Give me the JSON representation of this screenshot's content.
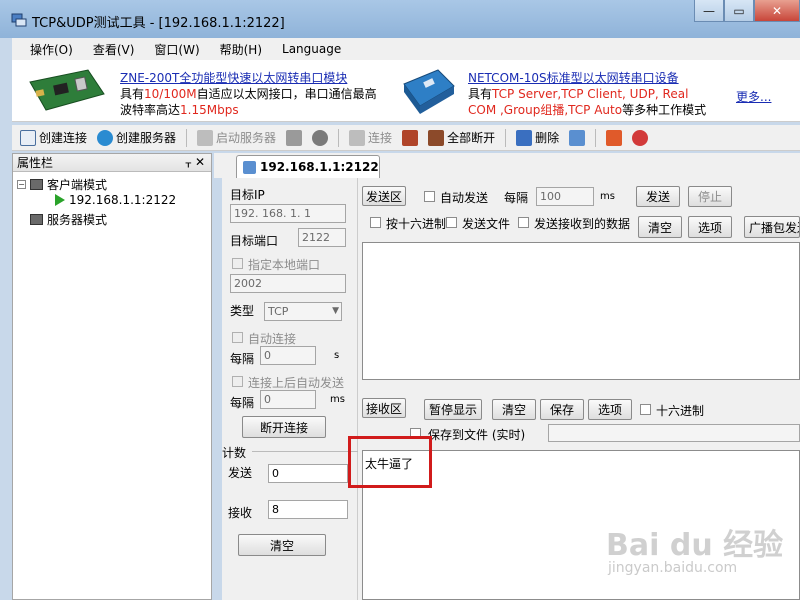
{
  "window": {
    "title": "TCP&UDP测试工具 - [192.168.1.1:2122]"
  },
  "menu": {
    "items": [
      "操作(O)",
      "查看(V)",
      "窗口(W)",
      "帮助(H)",
      "Language"
    ]
  },
  "banner": {
    "product1_title": "ZNE-200T全功能型快速以太网转串口模块",
    "product1_line2a": "具有",
    "product1_line2b": "10/100M",
    "product1_line2c": "自适应以太网接口，串口通信最高",
    "product1_line3a": "波特率高达",
    "product1_line3b": "1.15Mbps",
    "product2_title": "NETCOM-10S标准型以太网转串口设备",
    "product2_line2a": "具有",
    "product2_line2b": "TCP Server,TCP Client, UDP, Real",
    "product2_line3a": "COM ,Group组播,TCP Auto",
    "product2_line3b": "等多种工作模式",
    "more_link": "更多..."
  },
  "toolbar": {
    "create_connection": "创建连接",
    "create_server": "创建服务器",
    "start_server": "启动服务器",
    "connect": "连接",
    "disconnect_all": "全部断开",
    "delete": "删除"
  },
  "left_panel": {
    "title": "属性栏",
    "client_mode": "客户端模式",
    "client_item": "192.168.1.1:2122",
    "server_mode": "服务器模式"
  },
  "tab": {
    "label": "192.168.1.1:2122"
  },
  "settings": {
    "target_ip_label": "目标IP",
    "target_ip_value": "192. 168. 1. 1",
    "target_port_label": "目标端口",
    "target_port_value": "2122",
    "local_port_label": "指定本地端口",
    "local_port_value": "2002",
    "type_label": "类型",
    "type_value": "TCP",
    "auto_connect_label": "自动连接",
    "interval_label1": "每隔",
    "interval_value1": "0",
    "interval_unit1": "s",
    "auto_send_label": "连接上后自动发送",
    "interval_label2": "每隔",
    "interval_value2": "0",
    "interval_unit2": "ms",
    "disconnect_button": "断开连接",
    "count_label": "计数",
    "send_label": "发送",
    "send_value": "0",
    "recv_label": "接收",
    "recv_value": "8",
    "clear_button": "清空"
  },
  "send": {
    "area_label": "发送区",
    "auto_send": "自动发送",
    "interval_label": "每隔",
    "interval_value": "100",
    "unit": "ms",
    "send_button": "发送",
    "stop_button": "停止",
    "hex_label": "按十六进制",
    "send_file_label": "发送文件",
    "send_received_label": "发送接收到的数据",
    "clear_button": "清空",
    "options_button": "选项",
    "broadcast_button": "广播包发送"
  },
  "receive": {
    "area_label": "接收区",
    "pause_button": "暂停显示",
    "clear_button": "清空",
    "save_button": "保存",
    "options_button": "选项",
    "hex_label": "十六进制",
    "save_file_label": "保存到文件 (实时)",
    "content": "太牛逼了"
  },
  "watermark": {
    "brand": "Bai du 经验",
    "url": "jingyan.baidu.com"
  }
}
